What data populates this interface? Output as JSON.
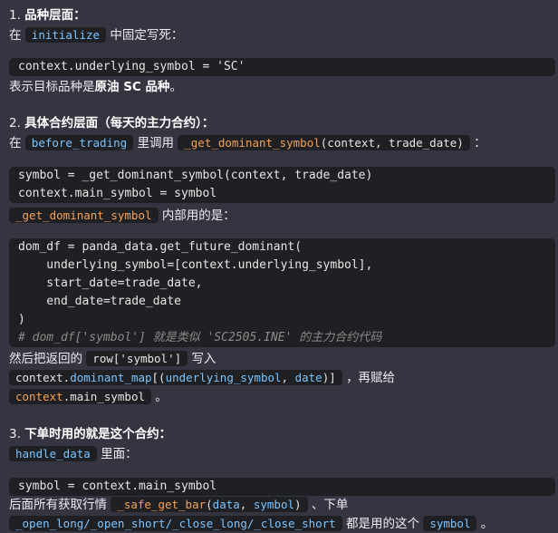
{
  "section1": {
    "heading_num": "1.",
    "heading": "品种层面：",
    "line_pre": "在",
    "line_code": "initialize",
    "line_post": "中固定写死：",
    "code": "context.underlying_symbol = 'SC'",
    "desc_pre": "表示目标品种是",
    "desc_bold": "原油 SC 品种",
    "desc_post": "。"
  },
  "section2": {
    "heading_num": "2.",
    "heading": "具体合约层面（每天的主力合约）：",
    "line_pre": "在",
    "line_code1": "before_trading",
    "line_mid": "里调用",
    "line_code2_fn": "_get_dominant_symbol",
    "line_code2_args": "(context, trade_date)",
    "line_post": "：",
    "code1_line1": "symbol = _get_dominant_symbol(context, trade_date)",
    "code1_line2": "context.main_symbol = symbol",
    "inner_code": "_get_dominant_symbol",
    "inner_post": "内部用的是：",
    "code2_line1": "dom_df = panda_data.get_future_dominant(",
    "code2_line2": "    underlying_symbol=[context.underlying_symbol],",
    "code2_line3": "    start_date=trade_date,",
    "code2_line4": "    end_date=trade_date",
    "code2_line5": ")",
    "code2_comment": "# dom_df['symbol'] 就是类似 'SC2505.INE' 的主力合约代码",
    "then_pre": "然后把返回的",
    "then_code": "row['symbol']",
    "then_post": "写入",
    "map_ctx": "context.",
    "map_attr": "dominant_map",
    "map_open": "[(",
    "map_k1": "underlying_symbol",
    "map_sep": ", ",
    "map_k2": "date",
    "map_close": ")]",
    "map_post": "，再赋给",
    "main_ctx": "context",
    "main_attr": ".main_symbol",
    "main_post": "。"
  },
  "section3": {
    "heading_num": "3.",
    "heading": "下单时用的就是这个合约：",
    "hd_code": "handle_data",
    "hd_post": "里面：",
    "code": "symbol = context.main_symbol",
    "after_pre": "后面所有获取行情",
    "after_fn": "_safe_get_bar",
    "after_args_open": "(",
    "after_arg1": "data",
    "after_args_sep": ", ",
    "after_arg2": "symbol",
    "after_args_close": ")",
    "after_post": "、下单",
    "orders_code": "_open_long/_open_short/_close_long/_close_short",
    "orders_mid": "都是用的这个",
    "orders_symbol": "symbol",
    "orders_post": "。"
  }
}
